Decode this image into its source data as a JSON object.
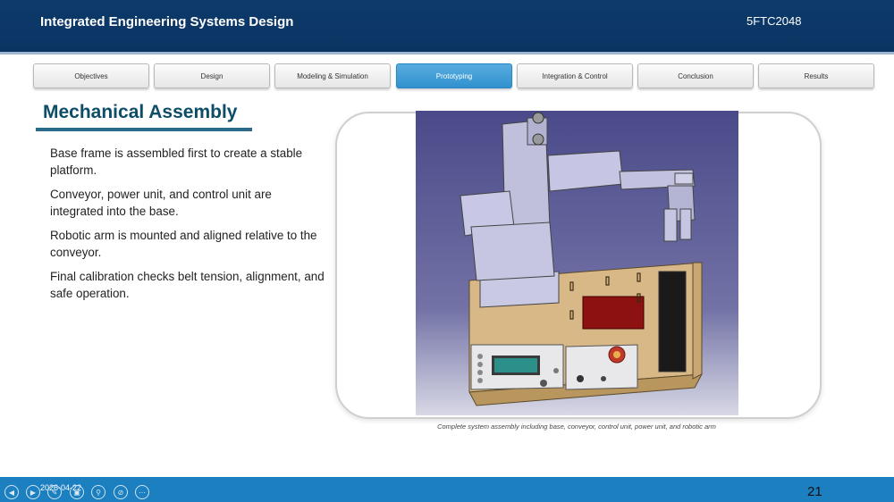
{
  "header": {
    "title": "Integrated Engineering Systems Design",
    "code": "5FTC2048"
  },
  "nav": {
    "tabs": [
      {
        "label": "Objectives"
      },
      {
        "label": "Design"
      },
      {
        "label": "Modeling & Simulation"
      },
      {
        "label": "Prototyping"
      },
      {
        "label": "Integration & Control"
      },
      {
        "label": "Conclusion"
      },
      {
        "label": "Results"
      }
    ],
    "active": "Prototyping"
  },
  "slide": {
    "title": "Mechanical Assembly",
    "bullets": [
      "Base frame is assembled first to create a stable platform.",
      "Conveyor, power unit, and control unit are integrated into the base.",
      "Robotic arm is mounted and aligned relative to the conveyor.",
      "Final calibration checks belt tension, alignment, and safe operation."
    ],
    "caption": "Complete system assembly including base, conveyor, control unit, power unit, and robotic arm"
  },
  "footer": {
    "date": "2026-04-22",
    "page": "21",
    "controls": [
      "previous-icon",
      "next-icon",
      "pen-icon",
      "slides-icon",
      "zoom-icon",
      "subtitles-icon",
      "more-icon"
    ]
  },
  "colors": {
    "header": "#0d3a6b",
    "footer": "#1b7fc0",
    "active_tab": "#3191cf",
    "title": "#0d4d68"
  }
}
